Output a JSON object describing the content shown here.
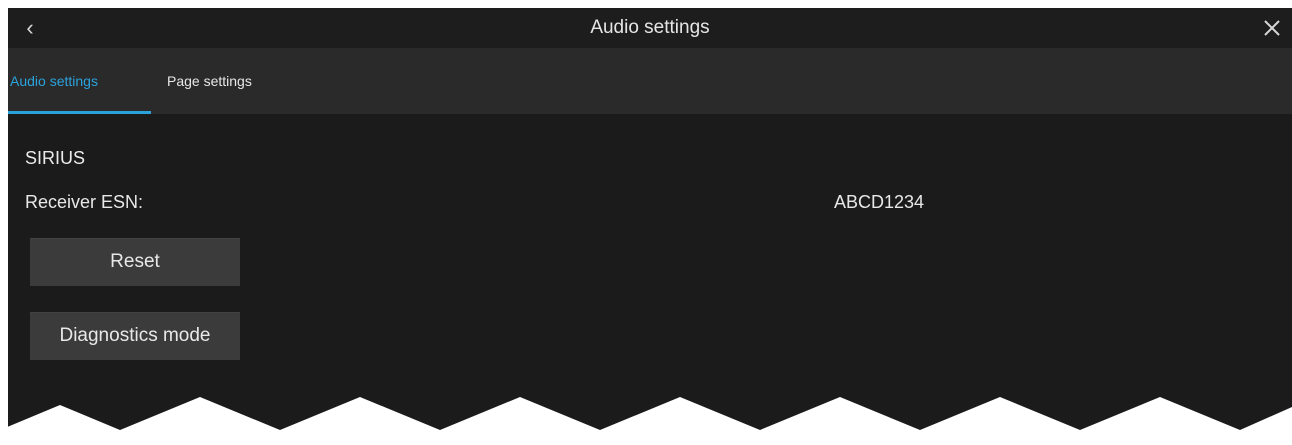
{
  "header": {
    "title": "Audio settings",
    "back_icon": "chevron-left-icon",
    "close_icon": "close-icon"
  },
  "tabs": [
    {
      "label": "Audio settings",
      "active": true
    },
    {
      "label": "Page settings",
      "active": false
    }
  ],
  "colors": {
    "accent": "#2aa3dd",
    "background": "#1b1b1b",
    "tabbar": "#2a2a2a",
    "button": "#3b3b3b"
  },
  "main": {
    "section_title": "SIRIUS",
    "receiver_esn_label": "Receiver ESN:",
    "receiver_esn_value": "ABCD1234",
    "reset_label": "Reset",
    "diagnostics_label": "Diagnostics mode"
  }
}
